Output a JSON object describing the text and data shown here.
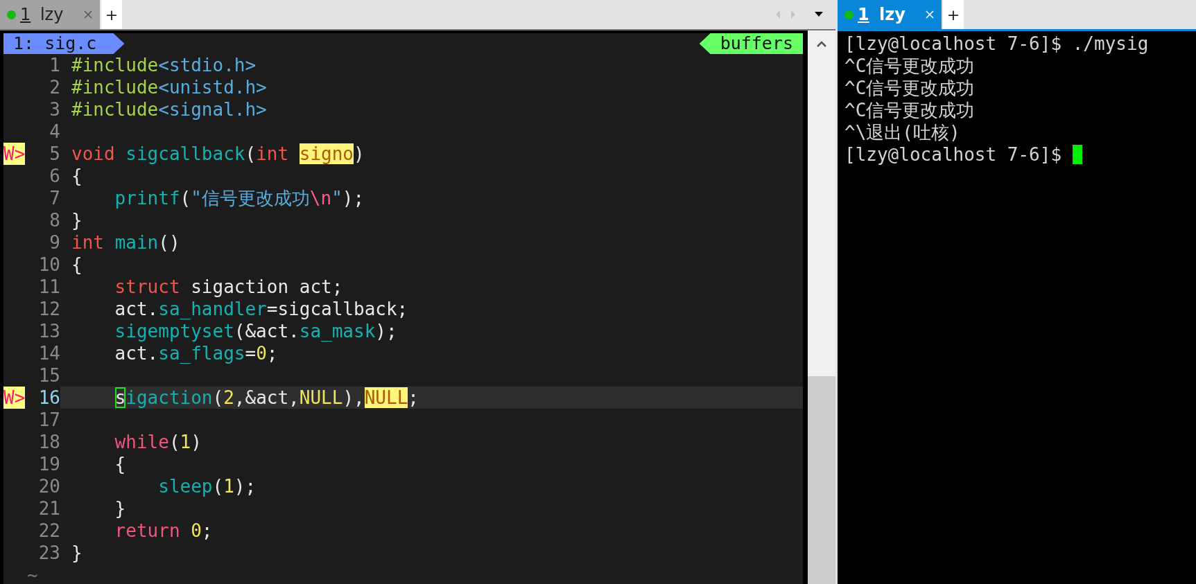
{
  "editor_pane": {
    "tabs": [
      {
        "number": "1",
        "name": "lzy",
        "selected": false,
        "color": "#11bb11"
      }
    ],
    "new_tab": "+",
    "tabline": {
      "buffer": "1: sig.c",
      "label": "buffers"
    },
    "lines": [
      {
        "number": "1",
        "current": false,
        "tokens": [
          {
            "kind": "preproc",
            "text": "#include"
          },
          {
            "kind": "path",
            "text": "<stdio.h>"
          }
        ]
      },
      {
        "number": "2",
        "current": false,
        "tokens": [
          {
            "kind": "preproc",
            "text": "#include"
          },
          {
            "kind": "path",
            "text": "<unistd.h>"
          }
        ]
      },
      {
        "number": "3",
        "current": false,
        "tokens": [
          {
            "kind": "preproc",
            "text": "#include"
          },
          {
            "kind": "path",
            "text": "<signal.h>"
          }
        ]
      },
      {
        "number": "4",
        "current": false
      },
      {
        "number": "5",
        "current": false,
        "sign": "W>",
        "tokens": [
          {
            "kind": "type",
            "text": "void "
          },
          {
            "kind": "func",
            "text": "sigcallback"
          },
          {
            "kind": "plain",
            "text": "("
          },
          {
            "kind": "type",
            "text": "int "
          },
          {
            "kind": "warn",
            "text": "signo"
          },
          {
            "kind": "plain",
            "text": ")"
          }
        ]
      },
      {
        "number": "6",
        "current": false,
        "tokens": [
          {
            "kind": "plain",
            "text": "{"
          }
        ]
      },
      {
        "number": "7",
        "current": false,
        "tokens": [
          {
            "kind": "func",
            "text": "    printf"
          },
          {
            "kind": "plain",
            "text": "("
          },
          {
            "kind": "path",
            "text": "\"信号更改成功"
          },
          {
            "kind": "escape",
            "text": "\\n"
          },
          {
            "kind": "path",
            "text": "\""
          },
          {
            "kind": "plain",
            "text": ");"
          }
        ]
      },
      {
        "number": "8",
        "current": false,
        "tokens": [
          {
            "kind": "plain",
            "text": "}"
          }
        ]
      },
      {
        "number": "9",
        "current": false,
        "tokens": [
          {
            "kind": "type",
            "text": "int "
          },
          {
            "kind": "func",
            "text": "main"
          },
          {
            "kind": "plain",
            "text": "()"
          }
        ]
      },
      {
        "number": "10",
        "current": false,
        "tokens": [
          {
            "kind": "plain",
            "text": "{"
          }
        ]
      },
      {
        "number": "11",
        "current": false,
        "tokens": [
          {
            "kind": "type",
            "text": "    struct"
          },
          {
            "kind": "plain",
            "text": " sigaction act;"
          }
        ]
      },
      {
        "number": "12",
        "current": false,
        "tokens": [
          {
            "kind": "plain",
            "text": "    act."
          },
          {
            "kind": "func",
            "text": "sa_handler"
          },
          {
            "kind": "plain",
            "text": "=sigcallback;"
          }
        ]
      },
      {
        "number": "13",
        "current": false,
        "tokens": [
          {
            "kind": "func",
            "text": "    sigemptyset"
          },
          {
            "kind": "plain",
            "text": "(&act."
          },
          {
            "kind": "func",
            "text": "sa_mask"
          },
          {
            "kind": "plain",
            "text": ");"
          }
        ]
      },
      {
        "number": "14",
        "current": false,
        "tokens": [
          {
            "kind": "plain",
            "text": "    act."
          },
          {
            "kind": "func",
            "text": "sa_flags"
          },
          {
            "kind": "plain",
            "text": "="
          },
          {
            "kind": "number",
            "text": "0"
          },
          {
            "kind": "plain",
            "text": ";"
          }
        ]
      },
      {
        "number": "15",
        "current": false
      },
      {
        "number": "16",
        "current": true,
        "sign": "W>",
        "tokens": [
          {
            "kind": "cursor",
            "text": "    s"
          },
          {
            "kind": "func",
            "text": "igaction"
          },
          {
            "kind": "plain",
            "text": "("
          },
          {
            "kind": "number",
            "text": "2"
          },
          {
            "kind": "plain",
            "text": ",&act,"
          },
          {
            "kind": "number",
            "text": "NULL"
          },
          {
            "kind": "plain",
            "text": "),"
          },
          {
            "kind": "warn",
            "text": "NULL"
          },
          {
            "kind": "plain",
            "text": ";"
          }
        ]
      },
      {
        "number": "17",
        "current": false
      },
      {
        "number": "18",
        "current": false,
        "tokens": [
          {
            "kind": "keyword",
            "text": "    while"
          },
          {
            "kind": "plain",
            "text": "("
          },
          {
            "kind": "number",
            "text": "1"
          },
          {
            "kind": "plain",
            "text": ")"
          }
        ]
      },
      {
        "number": "19",
        "current": false,
        "tokens": [
          {
            "kind": "plain",
            "text": "    {"
          }
        ]
      },
      {
        "number": "20",
        "current": false,
        "tokens": [
          {
            "kind": "func",
            "text": "        sleep"
          },
          {
            "kind": "plain",
            "text": "("
          },
          {
            "kind": "number",
            "text": "1"
          },
          {
            "kind": "plain",
            "text": ");"
          }
        ]
      },
      {
        "number": "21",
        "current": false,
        "tokens": [
          {
            "kind": "plain",
            "text": "    }"
          }
        ]
      },
      {
        "number": "22",
        "current": false,
        "tokens": [
          {
            "kind": "keyword",
            "text": "    return "
          },
          {
            "kind": "number",
            "text": "0"
          },
          {
            "kind": "plain",
            "text": ";"
          }
        ]
      },
      {
        "number": "23",
        "current": false,
        "tokens": [
          {
            "kind": "plain",
            "text": "}"
          }
        ]
      }
    ],
    "filler": "~"
  },
  "terminal_pane": {
    "tabs": [
      {
        "number": "1",
        "name": "lzy",
        "selected": true,
        "color": "#11bb11"
      }
    ],
    "new_tab": "+",
    "lines": [
      "[lzy@localhost 7-6]$ ./mysig",
      "^C信号更改成功",
      "^C信号更改成功",
      "^C信号更改成功",
      "^\\退出(吐核)",
      "[lzy@localhost 7-6]$"
    ],
    "cursor": true
  }
}
